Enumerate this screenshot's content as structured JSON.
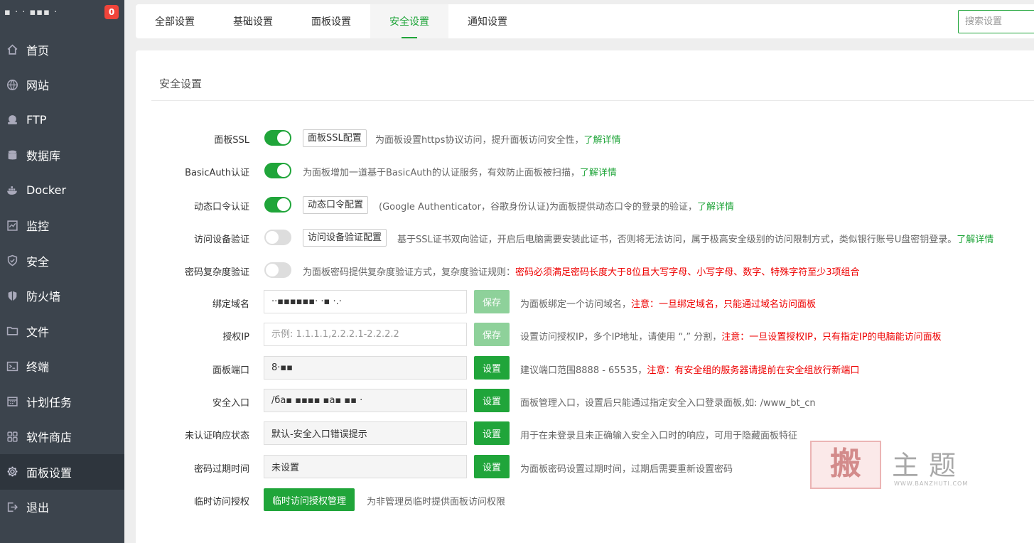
{
  "sidebar": {
    "server_name": "▪ · ·  ▪▪▪ ·",
    "badge_count": "0",
    "items": [
      {
        "label": "首页",
        "icon": "home-icon"
      },
      {
        "label": "网站",
        "icon": "globe-icon"
      },
      {
        "label": "FTP",
        "icon": "ftp-icon"
      },
      {
        "label": "数据库",
        "icon": "database-icon"
      },
      {
        "label": "Docker",
        "icon": "docker-icon"
      },
      {
        "label": "监控",
        "icon": "monitor-icon"
      },
      {
        "label": "安全",
        "icon": "shield-icon"
      },
      {
        "label": "防火墙",
        "icon": "firewall-icon"
      },
      {
        "label": "文件",
        "icon": "folder-icon"
      },
      {
        "label": "终端",
        "icon": "terminal-icon"
      },
      {
        "label": "计划任务",
        "icon": "calendar-icon"
      },
      {
        "label": "软件商店",
        "icon": "grid-icon"
      },
      {
        "label": "面板设置",
        "icon": "gear-icon",
        "active": true
      },
      {
        "label": "退出",
        "icon": "logout-icon"
      }
    ]
  },
  "tabs": [
    "全部设置",
    "基础设置",
    "面板设置",
    "安全设置",
    "通知设置"
  ],
  "active_tab": "安全设置",
  "search": {
    "placeholder": "搜索设置"
  },
  "panel": {
    "title": "安全设置"
  },
  "settings": {
    "ssl": {
      "label": "面板SSL",
      "enabled": true,
      "button": "面板SSL配置",
      "desc": "为面板设置https协议访问，提升面板访问安全性，",
      "link": "了解详情"
    },
    "basicauth": {
      "label": "BasicAuth认证",
      "enabled": true,
      "desc": "为面板增加一道基于BasicAuth的认证服务，有效防止面板被扫描，",
      "link": "了解详情"
    },
    "totp": {
      "label": "动态口令认证",
      "enabled": true,
      "button": "动态口令配置",
      "desc": "(Google Authenticator，谷歌身份认证)为面板提供动态口令的登录的验证，",
      "link": "了解详情"
    },
    "device": {
      "label": "访问设备验证",
      "enabled": false,
      "button": "访问设备验证配置",
      "desc": "基于SSL证书双向验证，开启后电脑需要安装此证书，否则将无法访问，属于极高安全级别的访问限制方式，类似银行账号U盘密钥登录。",
      "link": "了解详情"
    },
    "complexity": {
      "label": "密码复杂度验证",
      "enabled": false,
      "desc": "为面板密码提供复杂度验证方式，复杂度验证规则：",
      "warn": "密码必须满足密码长度大于8位且大写字母、小写字母、数字、特殊字符至少3项组合"
    },
    "domain": {
      "label": "绑定域名",
      "value": "··▪▪▪▪▪▪· ·▪ ·.·",
      "button": "保存",
      "desc": "为面板绑定一个访问域名，",
      "warn": "注意：一旦绑定域名，只能通过域名访问面板"
    },
    "auth_ip": {
      "label": "授权IP",
      "placeholder": "示例: 1.1.1.1,2.2.2.1-2.2.2.2",
      "button": "保存",
      "desc": "设置访问授权IP，多个IP地址，请使用 “,” 分割，",
      "warn": "注意：一旦设置授权IP，只有指定IP的电脑能访问面板"
    },
    "port": {
      "label": "面板端口",
      "value": "8·▪▪",
      "button": "设置",
      "desc": "建议端口范围8888 - 65535，",
      "warn": "注意：有安全组的服务器请提前在安全组放行新端口"
    },
    "entry": {
      "label": "安全入口",
      "value": "/ба▪ ▪▪▪▪ ▪a▪ ▪▪ ·",
      "button": "设置",
      "desc": "面板管理入口，设置后只能通过指定安全入口登录面板,如: /www_bt_cn"
    },
    "unauth": {
      "label": "未认证响应状态",
      "value": "默认-安全入口错误提示",
      "button": "设置",
      "desc": "用于在未登录且未正确输入安全入口时的响应，可用于隐藏面板特征"
    },
    "expire": {
      "label": "密码过期时间",
      "value": "未设置",
      "button": "设置",
      "desc": "为面板密码设置过期时间，过期后需要重新设置密码"
    },
    "temp": {
      "label": "临时访问授权",
      "button": "临时访问授权管理",
      "desc": "为非管理员临时提供面板访问权限"
    }
  },
  "watermark": {
    "seal": "搬",
    "text": "主题",
    "url": "WWW.BANZHUTI.COM"
  },
  "colors": {
    "accent": "#20a53a",
    "warn": "#ee0000",
    "sidebar": "#3c444d"
  }
}
